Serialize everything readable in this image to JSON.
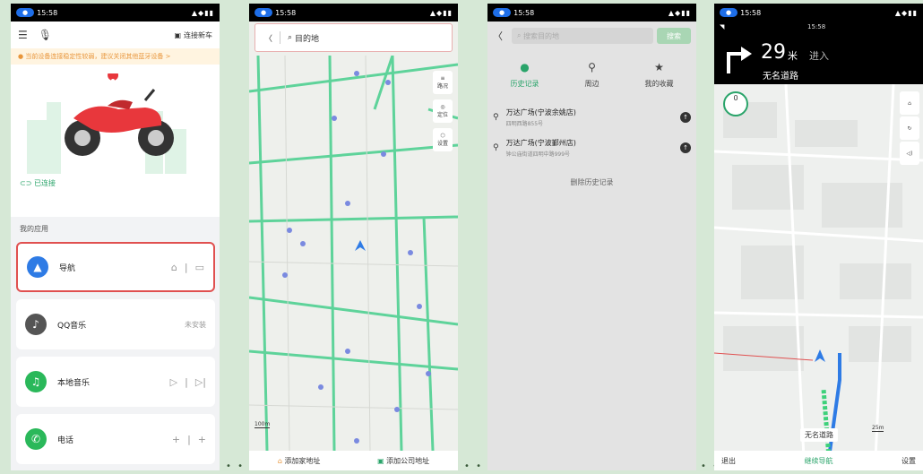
{
  "status": {
    "time": "15:58",
    "pill": "●"
  },
  "home": {
    "connect_label": "连接新车",
    "warning": "当前设备连接稳定性较弱，建议关闭其他蓝牙设备 >",
    "linked": "已连接",
    "apps_title": "我的应用",
    "apps": [
      {
        "name": "导航",
        "color": "#2e7be5"
      },
      {
        "name": "QQ音乐",
        "right": "未安装",
        "color": "#555555"
      },
      {
        "name": "本地音乐",
        "color": "#2ab85a"
      },
      {
        "name": "电话",
        "color": "#2ab85a"
      }
    ]
  },
  "map_search": {
    "placeholder": "目的地",
    "side": [
      "路况",
      "定位",
      "设置"
    ],
    "scale": "100m",
    "home_addr": "添加家地址",
    "company_addr": "添加公司地址"
  },
  "search_page": {
    "placeholder": "搜索目的地",
    "search_btn": "搜索",
    "tabs": [
      "历史记录",
      "周边",
      "我的收藏"
    ],
    "history": [
      {
        "title": "万达广场(宁波余姚店)",
        "sub": "四明西路855号"
      },
      {
        "title": "万达广场(宁波鄞州店)",
        "sub": "钟公庙街道四明中路999号"
      }
    ],
    "clear": "删除历史记录"
  },
  "navigation": {
    "distance": "29",
    "unit": "米",
    "action": "进入",
    "road": "无名道路",
    "clock": "15:58",
    "speed": "0",
    "road_tag": "无名道路",
    "scale": "25m",
    "exit": "退出",
    "continue": "继续导航",
    "settings": "设置"
  },
  "colors": {
    "accent": "#2aa46a",
    "primary": "#2e7be5",
    "warn": "#e8963c",
    "selected_border": "#e05050"
  }
}
